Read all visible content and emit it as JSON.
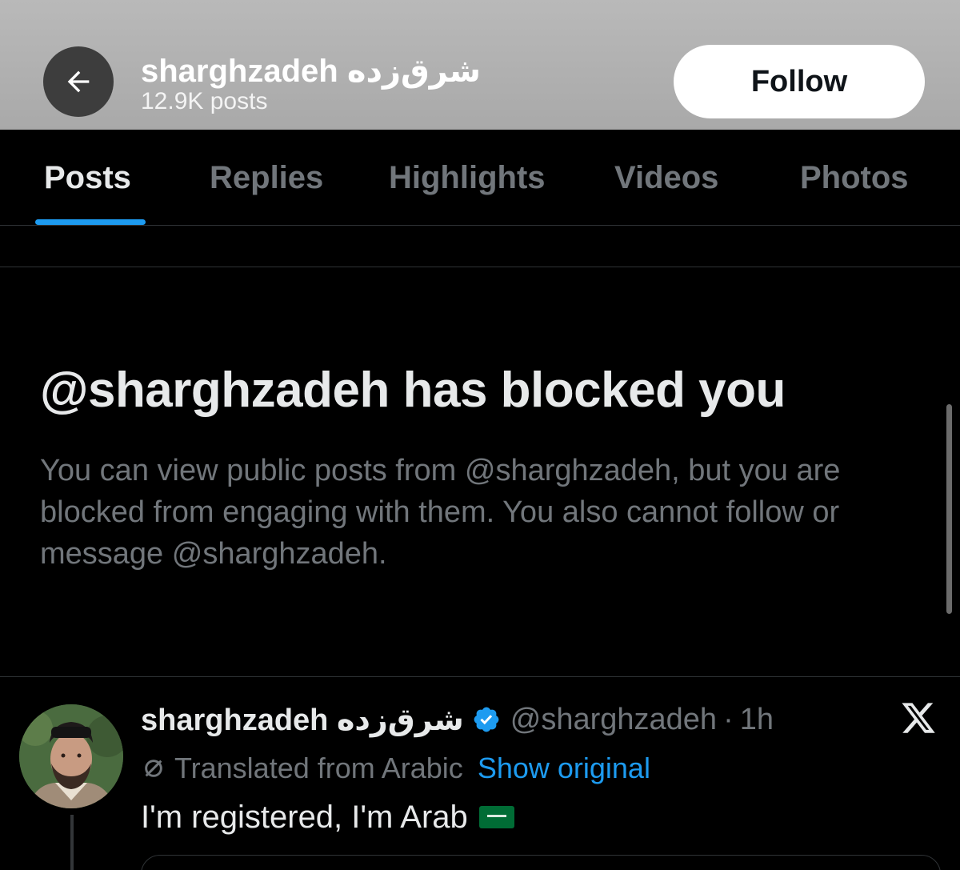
{
  "header": {
    "back_icon": "arrow-left-icon",
    "display_name": "sharghzadeh شرق‌زده",
    "post_count": "12.9K posts",
    "follow_label": "Follow"
  },
  "tabs": [
    {
      "label": "Posts",
      "active": true
    },
    {
      "label": "Replies",
      "active": false
    },
    {
      "label": "Highlights",
      "active": false
    },
    {
      "label": "Videos",
      "active": false
    },
    {
      "label": "Photos",
      "active": false
    }
  ],
  "blocked": {
    "title": "@sharghzadeh has blocked you",
    "body": "You can view public posts from @sharghzadeh, but you are blocked from engaging with them. You also cannot follow or message @sharghzadeh."
  },
  "post": {
    "display_name": "sharghzadeh شرق‌زده",
    "verified_icon": "verified-badge-icon",
    "handle": "@sharghzadeh",
    "separator": "·",
    "time": "1h",
    "translated_label": "Translated from Arabic",
    "show_original_label": "Show original",
    "text": "I'm registered, I'm Arab",
    "flag_icon": "saudi-flag-icon",
    "logo_icon": "x-logo-icon"
  },
  "colors": {
    "accent": "#1d9bf0",
    "background": "#000000",
    "muted_text": "#71767b",
    "primary_text": "#e7e9ea"
  }
}
